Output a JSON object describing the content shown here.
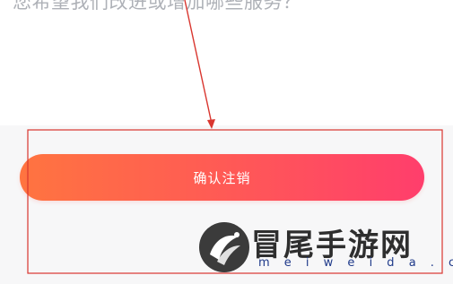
{
  "question": {
    "text": "您希望我们改进或增加哪些服务？"
  },
  "confirm_button": {
    "label": "确认注销",
    "gradient_start": "#ff7440",
    "gradient_end": "#ff3e6c"
  },
  "watermark": {
    "title": "冒尾手游网",
    "url": "m e i w e i d a . c o m"
  },
  "annotation": {
    "color": "#d9362f"
  }
}
